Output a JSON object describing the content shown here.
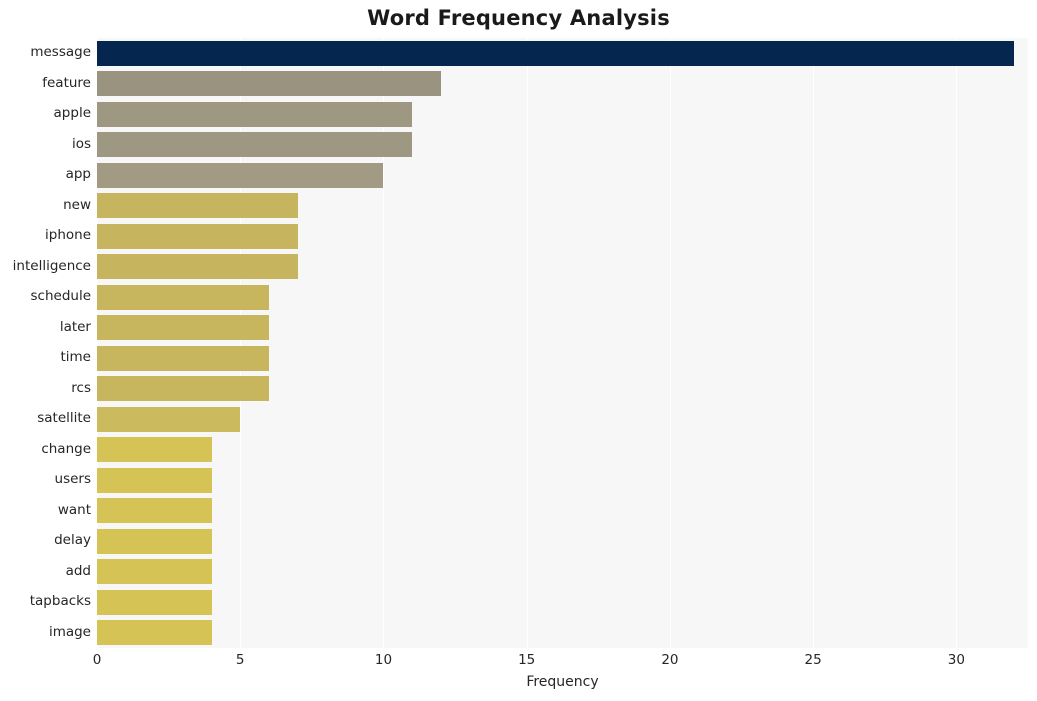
{
  "chart_data": {
    "type": "bar",
    "orientation": "horizontal",
    "title": "Word Frequency Analysis",
    "xlabel": "Frequency",
    "ylabel": "",
    "xlim": [
      0,
      32.5
    ],
    "grid": true,
    "legend": false,
    "xticks": [
      0,
      5,
      10,
      15,
      20,
      25,
      30
    ],
    "categories": [
      "message",
      "feature",
      "apple",
      "ios",
      "app",
      "new",
      "iphone",
      "intelligence",
      "schedule",
      "later",
      "time",
      "rcs",
      "satellite",
      "change",
      "users",
      "want",
      "delay",
      "add",
      "tapbacks",
      "image"
    ],
    "values": [
      32,
      12,
      11,
      11,
      10,
      7,
      7,
      7,
      6,
      6,
      6,
      6,
      5,
      4,
      4,
      4,
      4,
      4,
      4,
      4
    ],
    "colors": [
      "#04264f",
      "#9a937f",
      "#9e9781",
      "#9e9781",
      "#a29a83",
      "#c6b45f",
      "#c6b45f",
      "#c6b45f",
      "#c8b65e",
      "#c8b65e",
      "#c8b65e",
      "#c8b65e",
      "#ccba5e",
      "#d6c356",
      "#d6c356",
      "#d6c356",
      "#d6c356",
      "#d6c356",
      "#d6c356",
      "#d6c356"
    ],
    "plot_background": "#f7f7f7",
    "grid_color": "#ffffff"
  }
}
